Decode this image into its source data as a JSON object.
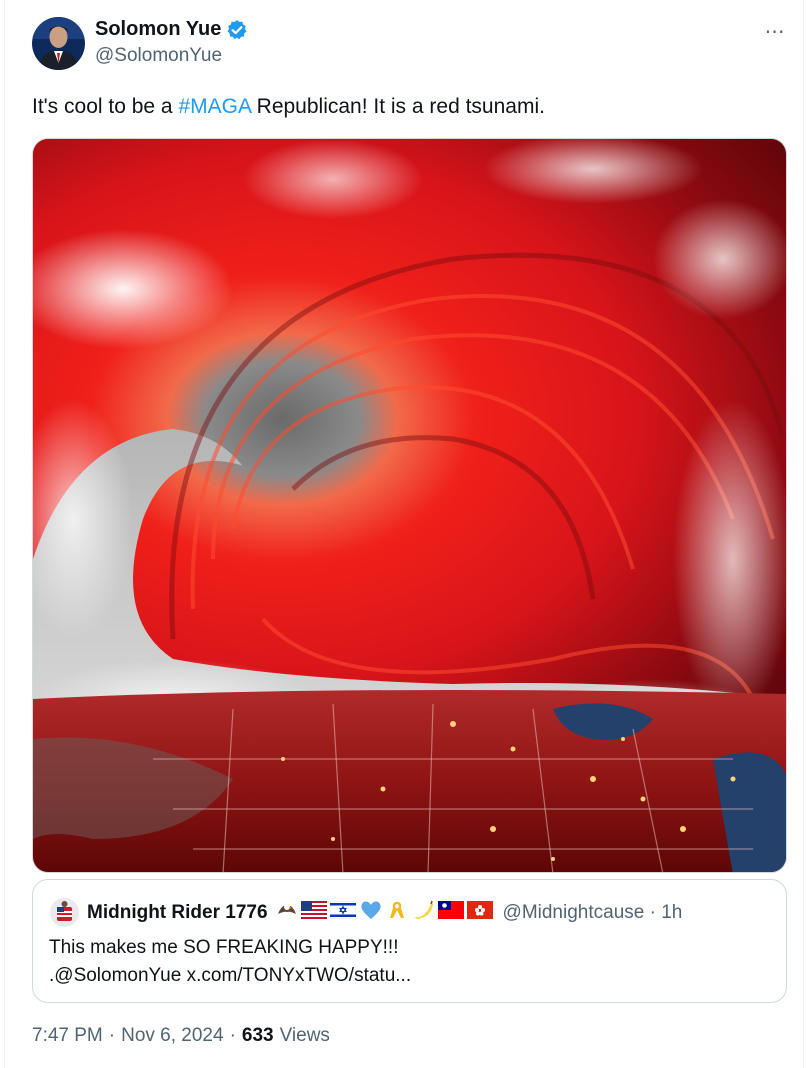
{
  "post": {
    "author_name": "Solomon Yue",
    "author_handle": "@SolomonYue",
    "text_before": "It's cool to be a ",
    "hashtag": "#MAGA",
    "text_after": " Republican! It is a red tsunami.",
    "more_icon": "⋯"
  },
  "quote": {
    "author_name": "Midnight Rider 1776",
    "author_handle": "@Midnightcause",
    "time": "1h",
    "line1": "This makes me SO FREAKING HAPPY!!!",
    "line2": ".@SolomonYue x.com/TONYxTWO/statu..."
  },
  "meta": {
    "time": "7:47 PM",
    "date": "Nov 6, 2024",
    "views_count": "633",
    "views_label": "Views",
    "sep": "·"
  },
  "colors": {
    "link": "#1d9bf0",
    "muted": "#536471",
    "verified": "#1d9bf0",
    "wave_red": "#d8141a"
  },
  "icons": [
    "verified-badge-icon",
    "more-options-icon",
    "eagle-emoji-icon",
    "us-flag-icon",
    "israel-flag-icon",
    "blue-heart-icon",
    "yellow-ribbon-icon",
    "banana-icon",
    "taiwan-flag-icon",
    "hong-kong-flag-icon"
  ]
}
